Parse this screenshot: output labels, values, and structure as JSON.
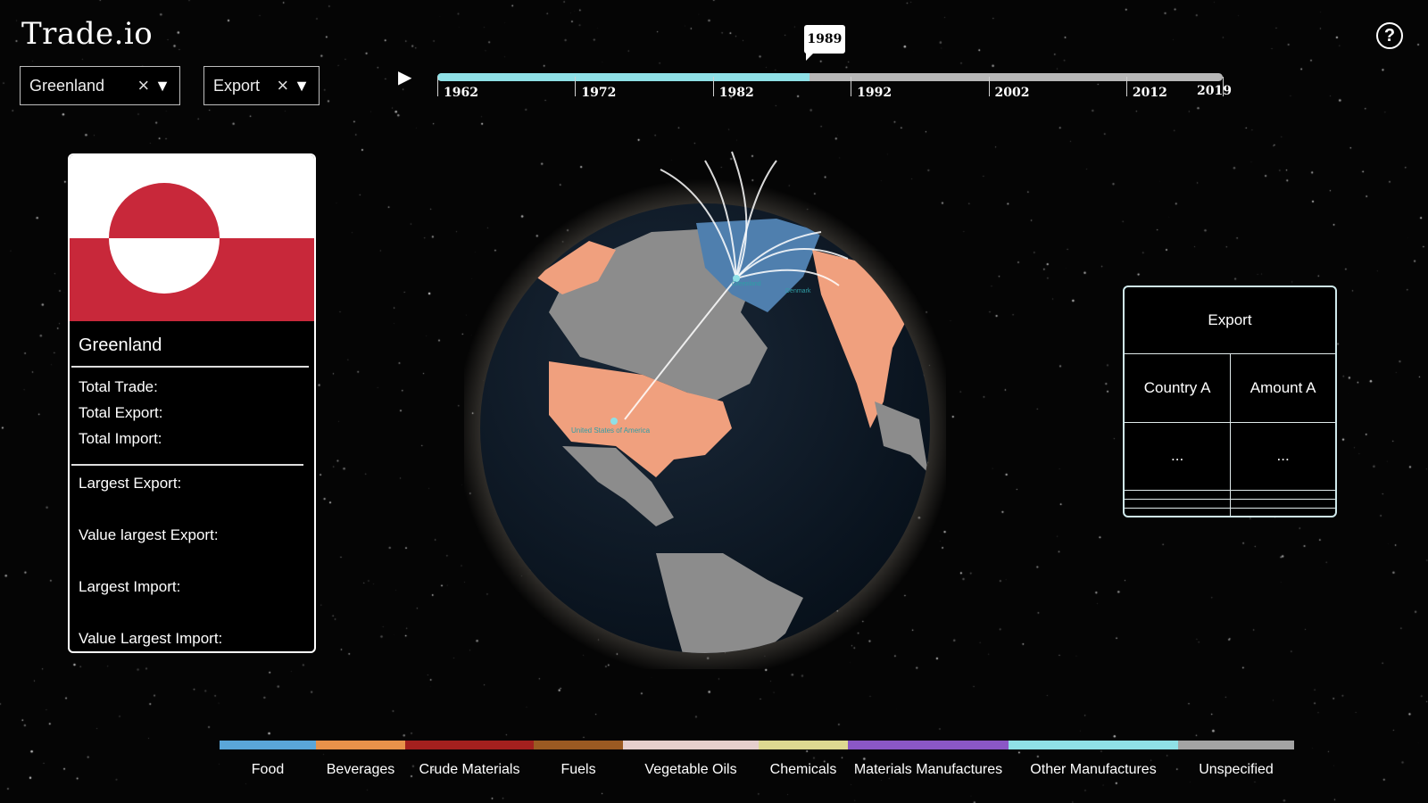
{
  "app": {
    "title": "Trade.io"
  },
  "country_select": {
    "value": "Greenland",
    "clear_icon": "close-icon",
    "caret_icon": "caret-down-icon"
  },
  "flow_select": {
    "value": "Export",
    "clear_icon": "close-icon",
    "caret_icon": "caret-down-icon"
  },
  "timeline": {
    "play_icon": "play-icon",
    "selected_year": "1989",
    "start_year": 1962,
    "end_year": 2019,
    "ticks": [
      "1962",
      "1972",
      "1982",
      "1992",
      "2002",
      "2012",
      "2019"
    ]
  },
  "help_icon": "?",
  "country_card": {
    "name": "Greenland",
    "total_trade_label": "Total Trade:",
    "total_export_label": "Total Export:",
    "total_import_label": "Total Import:",
    "largest_export_label": "Largest Export:",
    "value_largest_export_label": "Value largest Export:",
    "largest_import_label": "Largest Import:",
    "value_largest_import_label": "Value Largest Import:"
  },
  "export_panel": {
    "title": "Export",
    "col_country": "Country A",
    "col_amount": "Amount A",
    "rows": [
      [
        "...",
        "..."
      ],
      [
        "",
        ""
      ],
      [
        "",
        ""
      ],
      [
        "",
        ""
      ]
    ]
  },
  "map_labels": {
    "origin": "Greenland",
    "destination": "United States of America",
    "denmark": "Denmark"
  },
  "legend": [
    {
      "label": "Food",
      "color": "#5aa6d8"
    },
    {
      "label": "Beverages",
      "color": "#e8924a"
    },
    {
      "label": "Crude  Materials",
      "color": "#a3201e"
    },
    {
      "label": "Fuels",
      "color": "#9b5a22"
    },
    {
      "label": "Vegetable Oils",
      "color": "#e6cfcd"
    },
    {
      "label": "Chemicals",
      "color": "#ddd891"
    },
    {
      "label": "Materials Manufactures",
      "color": "#8a57c6"
    },
    {
      "label": "Other Manufactures",
      "color": "#8fe0e6"
    },
    {
      "label": "Unspecified",
      "color": "#a3a3a3"
    }
  ],
  "colors": {
    "selected_country": "#4f7fae",
    "partner_country": "#f0a07e",
    "land": "#8c8c8c",
    "ocean": "#0f1a28",
    "accent": "#8fe0e6"
  }
}
